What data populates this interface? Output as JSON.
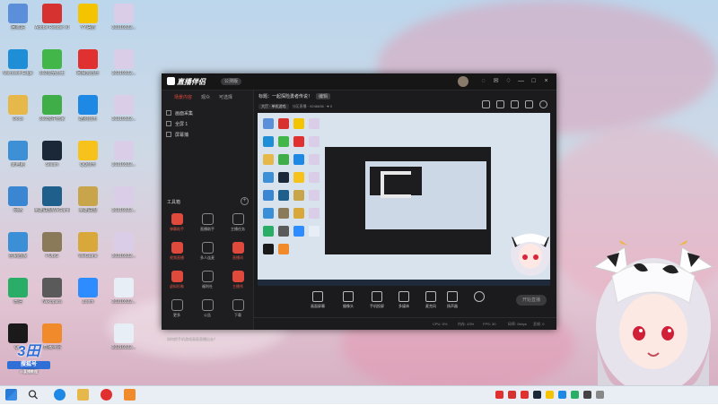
{
  "desktop": {
    "icons": [
      {
        "label": "回收站",
        "color": "#5b8fd9"
      },
      {
        "label": "Adobe Reader XI",
        "color": "#d6322f"
      },
      {
        "label": "YY语音",
        "color": "#f4c400"
      },
      {
        "label": "20210322...",
        "color": "#d9cde8"
      },
      {
        "label": "Microsoft Edge",
        "color": "#1e8fd6"
      },
      {
        "label": "360安全卫士",
        "color": "#42b649"
      },
      {
        "label": "网易云音乐",
        "color": "#e0302f"
      },
      {
        "label": "20210322...",
        "color": "#d9cde8"
      },
      {
        "label": "Docs",
        "color": "#e6b84a"
      },
      {
        "label": "360软件管家",
        "color": "#3fae49"
      },
      {
        "label": "酷狗音乐",
        "color": "#1e88e5"
      },
      {
        "label": "20210322...",
        "color": "#d9cde8"
      },
      {
        "label": "此电脑",
        "color": "#3d8fd6"
      },
      {
        "label": "Steam",
        "color": "#1b2838"
      },
      {
        "label": "QQ音乐",
        "color": "#f7c21b"
      },
      {
        "label": "20210322...",
        "color": "#d9cde8"
      },
      {
        "label": "网络",
        "color": "#3a86d2"
      },
      {
        "label": "英雄联盟WeGame",
        "color": "#1f5f8b"
      },
      {
        "label": "英雄联盟",
        "color": "#c8a44a"
      },
      {
        "label": "20210322...",
        "color": "#d9cde8"
      },
      {
        "label": "控制面板",
        "color": "#3a8fd6"
      },
      {
        "label": "PUBG",
        "color": "#8a7a5a"
      },
      {
        "label": "WeGame",
        "color": "#d8a93a"
      },
      {
        "label": "20210322...",
        "color": "#d9cde8"
      },
      {
        "label": "微信",
        "color": "#2aae67"
      },
      {
        "label": "Nekopara",
        "color": "#5a5a5a"
      },
      {
        "label": "Zoom",
        "color": "#2d8cff"
      },
      {
        "label": "20210322...",
        "color": "#e8eef6"
      },
      {
        "label": "QQ",
        "color": "#1a1a1a"
      },
      {
        "label": "直播伴侣",
        "color": "#f08a2a"
      },
      {
        "label": "",
        "color": "rgba(0,0,0,0)"
      },
      {
        "label": "20210322...",
        "color": "#e8eef6"
      }
    ]
  },
  "app": {
    "title": "直播伴侣",
    "version_badge": "公测版",
    "window_controls": [
      "—",
      "□",
      "×"
    ],
    "left_tabs": [
      "场景内容",
      "观众",
      "可选择"
    ],
    "scenes": [
      "画面采集",
      "全屏 1",
      "屏幕捕"
    ],
    "tools_title": "工具箱",
    "tools": [
      {
        "label": "弹幕助手",
        "red": true
      },
      {
        "label": "直播助手",
        "red": false
      },
      {
        "label": "主播任务",
        "red": false
      },
      {
        "label": "视频直播",
        "red": true
      },
      {
        "label": "多人连麦",
        "red": false
      },
      {
        "label": "直播间",
        "red": true
      },
      {
        "label": "虚拟形象",
        "red": true
      },
      {
        "label": "福利社",
        "red": false
      },
      {
        "label": "主播秀",
        "red": true
      },
      {
        "label": "更多",
        "red": false
      },
      {
        "label": "公告",
        "red": false
      },
      {
        "label": "下载",
        "red": false
      }
    ],
    "notice": "如何把手机游戏画面直播出去？",
    "main_title": "标题：一起探险勇者传说！",
    "edit_label": "编辑",
    "category_tag": "大厅 · 单机游戏",
    "stats_text": "分区直播 · 9246636",
    "likes": "0",
    "bottom_tools": [
      "画面屏幕",
      "摄像头",
      "手机投屏",
      "多媒体",
      "麦克风",
      "扬声器"
    ],
    "go_live": "开始直播",
    "status": [
      "CPU: 5%",
      "内存: 43%",
      "FPS: 30",
      "码率: 0kbps",
      "丢帧: 0"
    ]
  },
  "watermark": {
    "logo": "3田",
    "sub": "搜狐号",
    "foot": "@直播教程"
  },
  "taskbar": {
    "tray_time": ""
  }
}
